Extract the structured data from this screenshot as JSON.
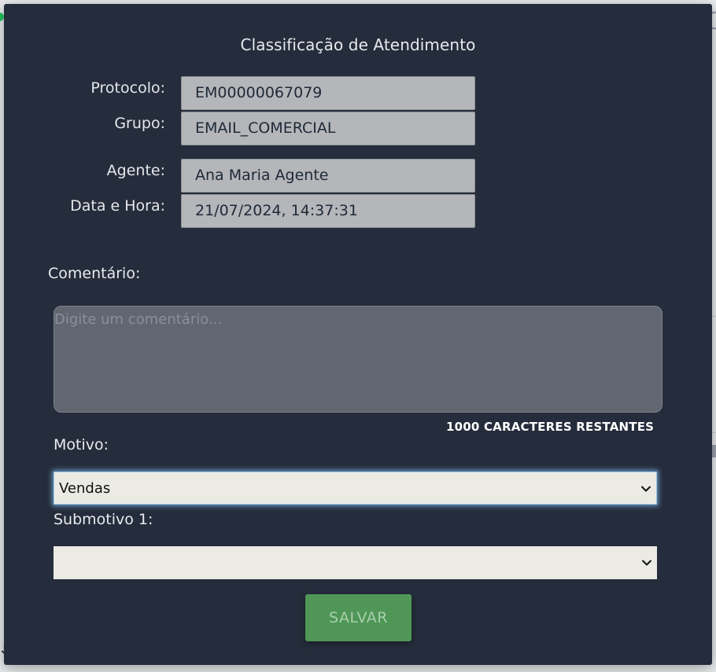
{
  "modal": {
    "title": "Classificação de Atendimento"
  },
  "info": {
    "protocolo_label": "Protocolo:",
    "protocolo_value": "EM00000067079",
    "grupo_label": "Grupo:",
    "grupo_value": "EMAIL_COMERCIAL",
    "agente_label": "Agente:",
    "agente_value": "Ana Maria Agente",
    "data_label": "Data e Hora:",
    "data_value": "21/07/2024, 14:37:31"
  },
  "comment": {
    "label": "Comentário:",
    "placeholder": "Digite um comentário...",
    "counter": "1000 CARACTERES RESTANTES"
  },
  "motivo": {
    "label": "Motivo:",
    "selected": "Vendas"
  },
  "submotivo": {
    "label": "Submotivo 1:",
    "selected": ""
  },
  "actions": {
    "save_label": "SALVAR"
  },
  "icons": {
    "select_arrow": "chevron-down-icon",
    "status_dot": "status-dot-icon",
    "arrow": "arrow-down-icon"
  },
  "colors": {
    "modal_bg": "#252c3b",
    "field_bg": "#b4b6ba",
    "select_bg": "#ebebe4",
    "save_button": "#4f9657"
  }
}
